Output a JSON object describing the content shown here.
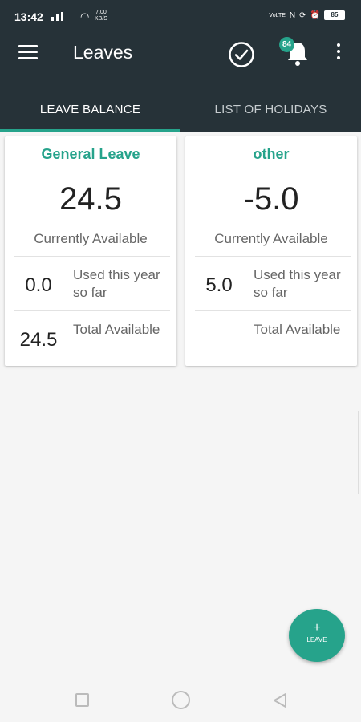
{
  "status_bar": {
    "time": "13:42",
    "speed_value": "7.00",
    "speed_unit": "KB/S",
    "volte": "VoLTE",
    "battery": "85"
  },
  "header": {
    "title": "Leaves",
    "notification_count": "84",
    "accent_color": "#26a38b",
    "bar_color": "#263238"
  },
  "tabs": [
    {
      "label": "LEAVE BALANCE",
      "active": true
    },
    {
      "label": "LIST OF HOLIDAYS",
      "active": false
    }
  ],
  "cards": [
    {
      "title": "General Leave",
      "available": "24.5",
      "available_label": "Currently Available",
      "used": "0.0",
      "used_label": "Used this year so far",
      "total": "24.5",
      "total_label": "Total Available"
    },
    {
      "title": "other",
      "available": "-5.0",
      "available_label": "Currently Available",
      "used": "5.0",
      "used_label": "Used this year so far",
      "total": "",
      "total_label": "Total Available"
    }
  ],
  "fab": {
    "icon": "plus",
    "label": "LEAVE"
  },
  "nav": {
    "icons": [
      "square-icon",
      "circle-icon",
      "back-icon"
    ]
  }
}
